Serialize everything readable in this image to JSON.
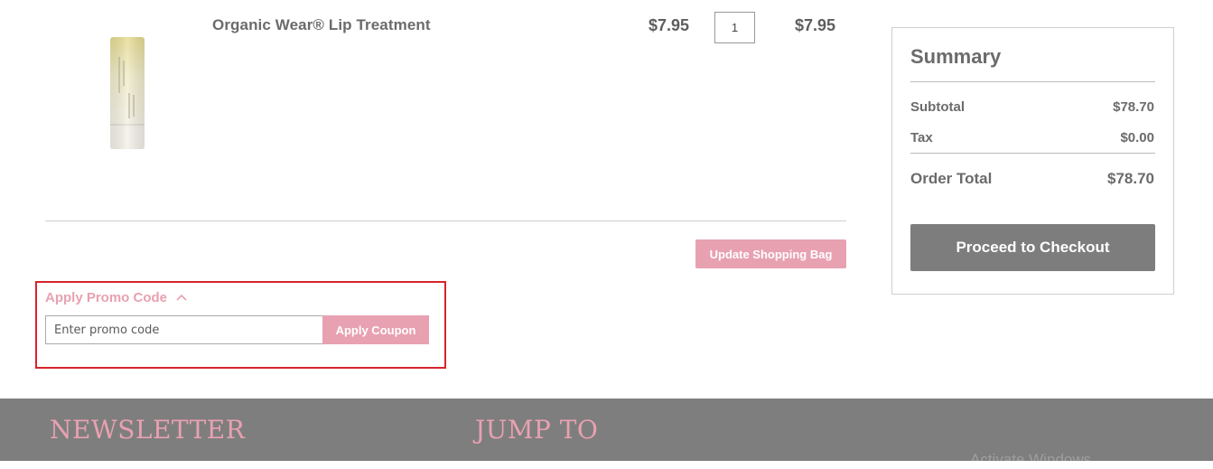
{
  "cart": {
    "item": {
      "name": "Organic Wear® Lip Treatment",
      "unit_price": "$7.95",
      "quantity": "1",
      "row_total": "$7.95",
      "image_icon": "lip-treatment-tube-image"
    },
    "update_label": "Update Shopping Bag"
  },
  "promo": {
    "title": "Apply Promo Code",
    "expanded": true,
    "input_placeholder": "Enter promo code",
    "apply_label": "Apply Coupon"
  },
  "summary": {
    "title": "Summary",
    "rows": [
      {
        "label": "Subtotal",
        "value": "$78.70"
      },
      {
        "label": "Tax",
        "value": "$0.00"
      }
    ],
    "total_label": "Order Total",
    "total_value": "$78.70",
    "checkout_label": "Proceed to Checkout"
  },
  "footer": {
    "newsletter_heading": "NEWSLETTER",
    "jump_heading": "JUMP TO",
    "watermark": "Activate Windows"
  },
  "colors": {
    "accent_pink": "#e8a1b1",
    "checkout_gray": "#7d7d7d",
    "footer_gray": "#7e7e7e",
    "highlight_red": "#d7242c"
  }
}
